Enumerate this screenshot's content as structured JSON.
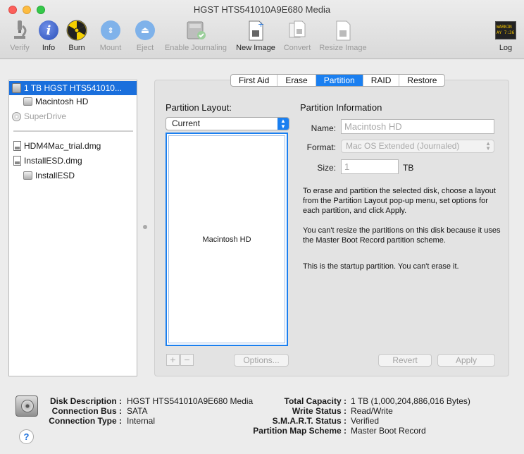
{
  "window": {
    "title": "HGST HTS541010A9E680 Media"
  },
  "toolbar": {
    "verify": "Verify",
    "info": "Info",
    "burn": "Burn",
    "mount": "Mount",
    "eject": "Eject",
    "enable_journaling": "Enable Journaling",
    "new_image": "New Image",
    "convert": "Convert",
    "resize_image": "Resize Image",
    "log": "Log",
    "log_icon_text": "WARNIN\nAY 7:36"
  },
  "sidebar": {
    "items": [
      {
        "label": "1 TB HGST HTS541010..."
      },
      {
        "label": "Macintosh HD"
      },
      {
        "label": "SuperDrive"
      },
      {
        "label": "HDM4Mac_trial.dmg"
      },
      {
        "label": "InstallESD.dmg"
      },
      {
        "label": "InstallESD"
      }
    ]
  },
  "tabs": [
    "First Aid",
    "Erase",
    "Partition",
    "RAID",
    "Restore"
  ],
  "partition": {
    "layout_label": "Partition Layout:",
    "layout_value": "Current",
    "partition_name": "Macintosh HD",
    "info_title": "Partition Information",
    "name_label": "Name:",
    "name_value": "Macintosh HD",
    "format_label": "Format:",
    "format_value": "Mac OS Extended (Journaled)",
    "size_label": "Size:",
    "size_value": "1",
    "size_unit": "TB",
    "desc1": "To erase and partition the selected disk, choose a layout from the Partition Layout pop-up menu, set options for each partition, and click Apply.",
    "desc2": "You can't resize the partitions on this disk because it uses the Master Boot Record partition scheme.",
    "desc3": "This is the startup partition. You can't erase it.",
    "add": "+",
    "remove": "−",
    "options": "Options...",
    "revert": "Revert",
    "apply": "Apply"
  },
  "disk_info": {
    "left": [
      {
        "key": "Disk Description :",
        "value": "HGST HTS541010A9E680 Media"
      },
      {
        "key": "Connection Bus :",
        "value": "SATA"
      },
      {
        "key": "Connection Type :",
        "value": "Internal"
      }
    ],
    "right": [
      {
        "key": "Total Capacity :",
        "value": "1 TB (1,000,204,886,016 Bytes)"
      },
      {
        "key": "Write Status :",
        "value": "Read/Write"
      },
      {
        "key": "S.M.A.R.T. Status :",
        "value": "Verified"
      },
      {
        "key": "Partition Map Scheme :",
        "value": "Master Boot Record"
      }
    ]
  },
  "help": "?",
  "colors": {
    "accent": "#1a7ff0",
    "selection": "#1a6fdc"
  }
}
